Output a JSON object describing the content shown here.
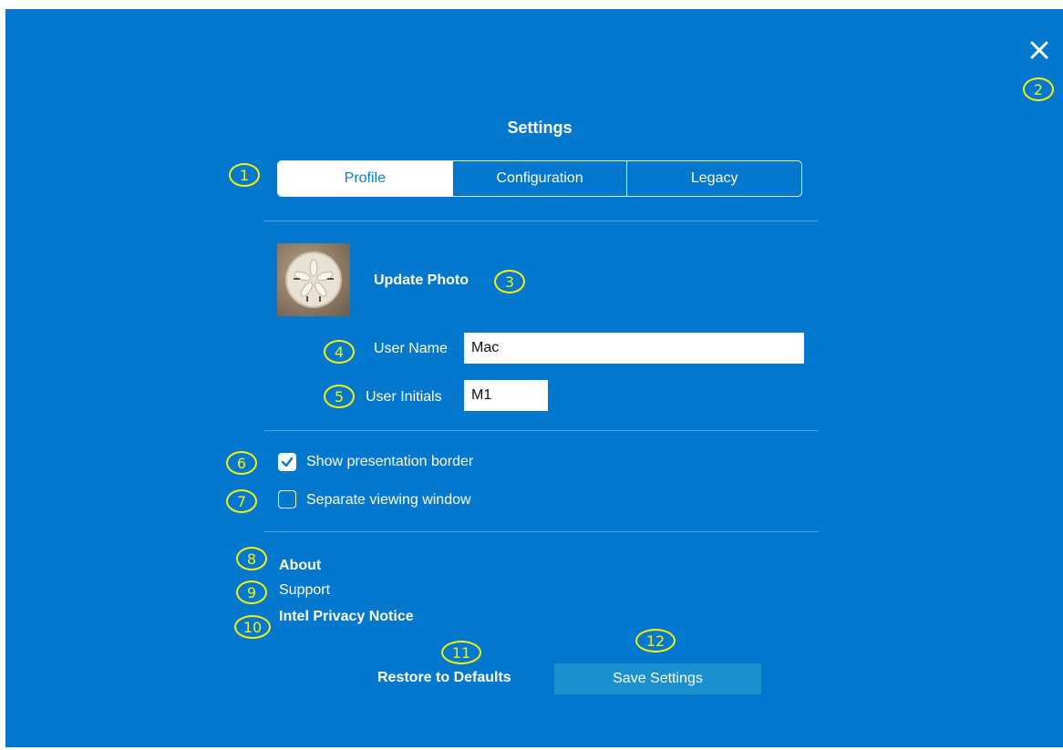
{
  "dialog": {
    "title": "Settings",
    "accent_color": "#0477cf",
    "close_icon": "close-icon"
  },
  "tabs": [
    {
      "label": "Profile",
      "active": true
    },
    {
      "label": "Configuration",
      "active": false
    },
    {
      "label": "Legacy",
      "active": false
    }
  ],
  "profile": {
    "update_photo_label": "Update Photo",
    "user_name_label": "User Name",
    "user_name_value": "Mac",
    "user_initials_label": "User Initials",
    "user_initials_value": "M1"
  },
  "options": [
    {
      "label": "Show presentation border",
      "checked": true
    },
    {
      "label": "Separate viewing window",
      "checked": false
    }
  ],
  "links": {
    "about": "About",
    "support": "Support",
    "privacy": "Intel Privacy Notice"
  },
  "actions": {
    "restore_label": "Restore to Defaults",
    "save_label": "Save Settings"
  },
  "callouts": [
    "1",
    "2",
    "3",
    "4",
    "5",
    "6",
    "7",
    "8",
    "9",
    "10",
    "11",
    "12"
  ]
}
